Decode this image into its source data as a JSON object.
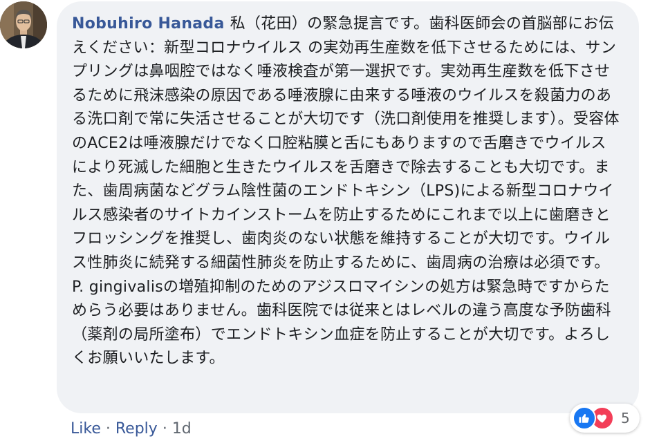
{
  "comment": {
    "author": "Nobuhiro Hanada",
    "text": "私（花田）の緊急提言です。歯科医師会の首脳部にお伝えください：新型コロナウイルス の実効再生産数を低下させるためには、サンプリングは鼻咽腔ではなく唾液検査が第一選択です。実効再生産数を低下させるために飛沫感染の原因である唾液腺に由来する唾液のウイルスを殺菌力のある洗口剤で常に失活させることが大切です（洗口剤使用を推奨します）。受容体のACE2は唾液腺だけでなく口腔粘膜と舌にもありますので舌磨きでウイルスにより死滅した細胞と生きたウイルスを舌磨きで除去することも大切です。また、歯周病菌などグラム陰性菌のエンドトキシン（LPS)による新型コロナウイルス感染者のサイトカインストームを防止するためにこれまで以上に歯磨きとフロッシングを推奨し、歯肉炎のない状態を維持することが大切です。ウイルス性肺炎に続発する細菌性肺炎を防止するために、歯周病の治療は必須です。P. gingivalisの増殖抑制のためのアジスロマイシンの処方は緊急時ですからためらう必要はありません。歯科医院では従来とはレベルの違う高度な予防歯科（薬剤の局所塗布）でエンドトキシン血症を防止することが大切です。よろしくお願いいたします。"
  },
  "actions": {
    "like": "Like",
    "reply": "Reply",
    "separator": "·",
    "time": "1d"
  },
  "reactions": {
    "types": [
      "like-icon",
      "love-icon"
    ],
    "count": "5",
    "colors": {
      "like": "#1877f2",
      "love": "#f33e58"
    }
  },
  "colors": {
    "bubble": "#f0f2f5",
    "author": "#385898",
    "text": "#1c1e21"
  }
}
